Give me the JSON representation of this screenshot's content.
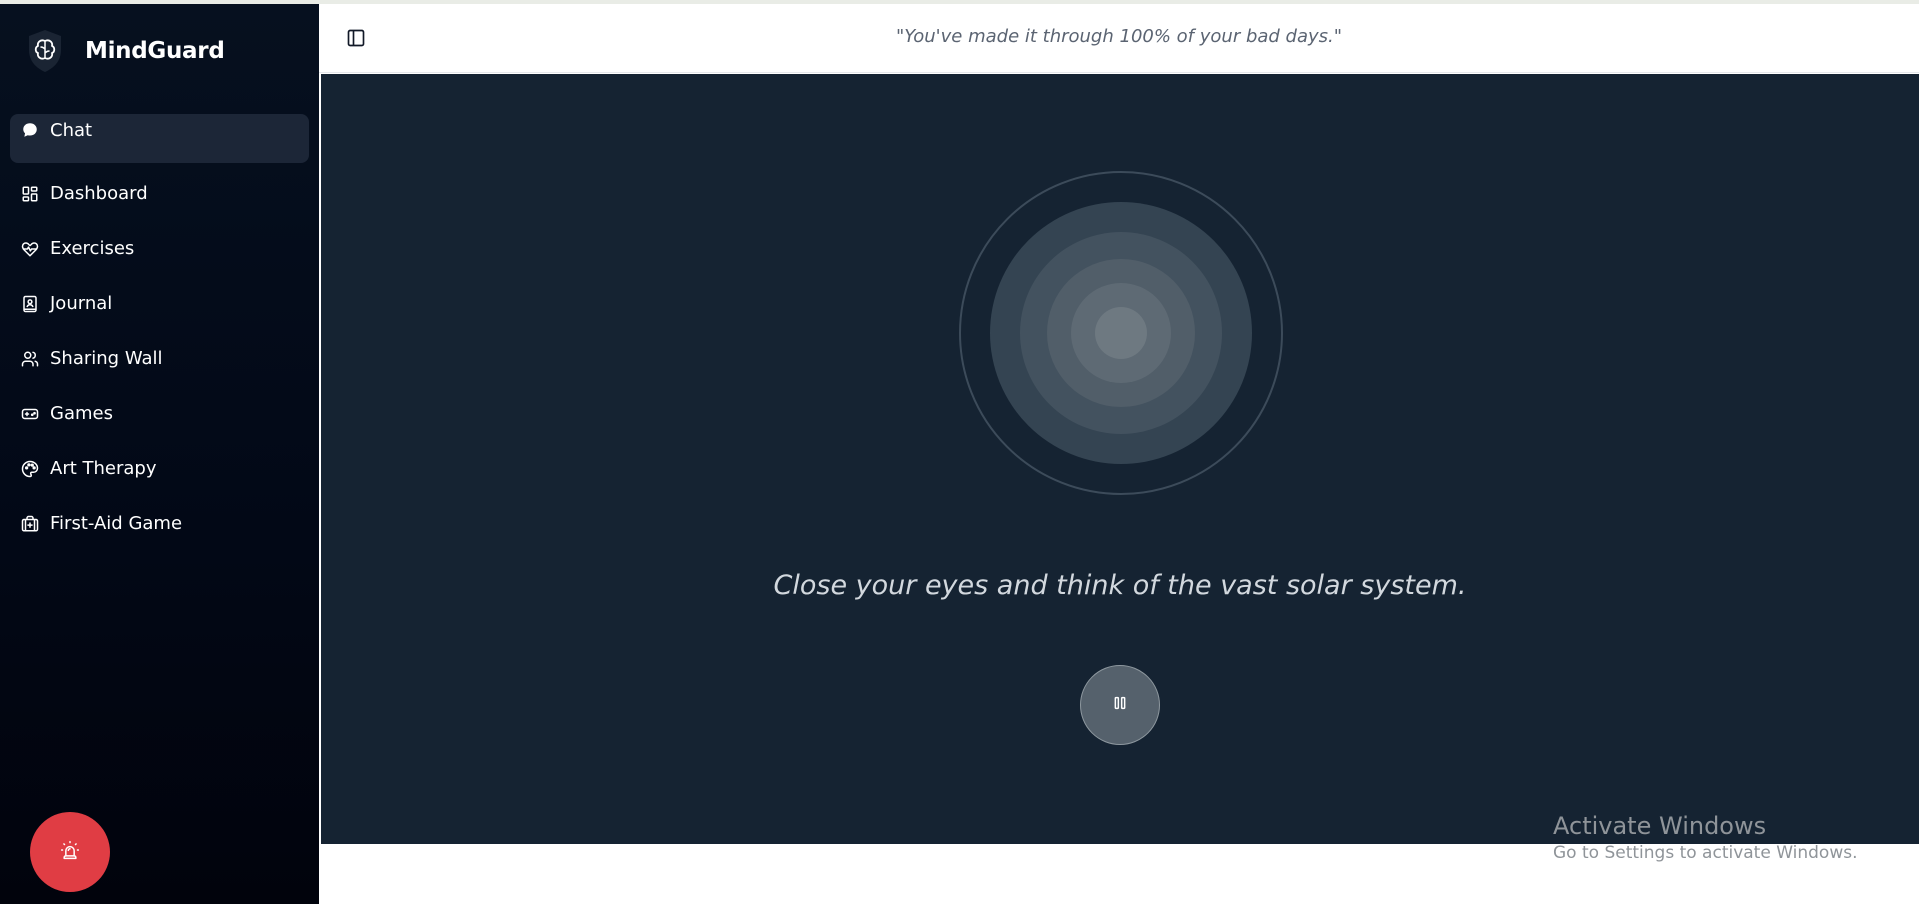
{
  "app": {
    "name": "MindGuard",
    "logo_icon": "brain-shield-icon"
  },
  "sidebar": {
    "items": [
      {
        "label": "Chat",
        "icon": "chat-bubble-icon",
        "active": true
      },
      {
        "label": "Dashboard",
        "icon": "dashboard-grid-icon",
        "active": false
      },
      {
        "label": "Exercises",
        "icon": "heart-pulse-icon",
        "active": false
      },
      {
        "label": "Journal",
        "icon": "journal-icon",
        "active": false
      },
      {
        "label": "Sharing Wall",
        "icon": "users-icon",
        "active": false
      },
      {
        "label": "Games",
        "icon": "gamepad-icon",
        "active": false
      },
      {
        "label": "Art Therapy",
        "icon": "palette-icon",
        "active": false
      },
      {
        "label": "First-Aid Game",
        "icon": "first-aid-kit-icon",
        "active": false
      }
    ],
    "sos_icon": "siren-icon"
  },
  "header": {
    "toggle_icon": "panel-left-icon",
    "quote": "\"You've made it through 100% of your bad days.\""
  },
  "exercise": {
    "instruction": "Close your eyes and think of the vast solar system.",
    "control_icon": "pause-icon"
  },
  "watermark": {
    "title": "Activate Windows",
    "subtitle": "Go to Settings to activate Windows."
  },
  "colors": {
    "sidebar_bg": "#020816",
    "active_item_bg": "#1c2637",
    "main_bg": "#152332",
    "sos_button": "#e03d44",
    "quote_text": "#5b6472"
  }
}
